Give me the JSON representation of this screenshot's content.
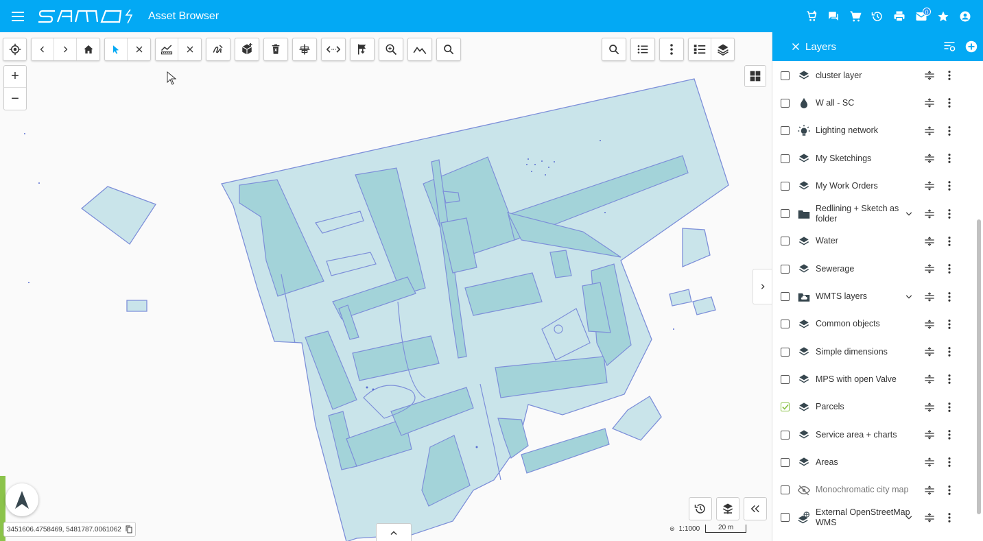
{
  "app": {
    "title": "Asset Browser",
    "logo_text": "samo"
  },
  "header": {
    "actions": [
      {
        "name": "cart-add-icon"
      },
      {
        "name": "chat-icon"
      },
      {
        "name": "cart-icon"
      },
      {
        "name": "history-icon"
      },
      {
        "name": "print-icon"
      },
      {
        "name": "mail-icon",
        "badge": "0"
      },
      {
        "name": "star-icon"
      },
      {
        "name": "account-icon"
      }
    ]
  },
  "colors": {
    "primary": "#03a9f4",
    "map_fill": "#c9e4ea",
    "map_stroke": "#7d8fd9",
    "accent_green": "#8bc34a"
  },
  "map": {
    "coordinates": "3451606.4758469, 5481787.0061062",
    "scale_ratio": "1:1000",
    "scale_bar": "20 m",
    "zoom_in": "+",
    "zoom_out": "−"
  },
  "panel": {
    "title": "Layers",
    "layers": [
      {
        "name": "cluster layer",
        "icon": "layers-icon",
        "checked": false
      },
      {
        "name": "W all - SC",
        "icon": "drop-icon",
        "checked": false
      },
      {
        "name": "Lighting network",
        "icon": "lightbulb-icon",
        "checked": false
      },
      {
        "name": "My Sketchings",
        "icon": "layers-icon",
        "checked": false
      },
      {
        "name": "My Work Orders",
        "icon": "layers-icon",
        "checked": false
      },
      {
        "name": "Redlining + Sketch as folder",
        "icon": "folder-icon",
        "checked": false,
        "expandable": true
      },
      {
        "name": "Water",
        "icon": "layers-icon",
        "checked": false
      },
      {
        "name": "Sewerage",
        "icon": "layers-icon",
        "checked": false
      },
      {
        "name": "WMTS layers",
        "icon": "folder-cloud-icon",
        "checked": false,
        "expandable": true
      },
      {
        "name": "Common objects",
        "icon": "layers-icon",
        "checked": false
      },
      {
        "name": "Simple dimensions",
        "icon": "layers-icon",
        "checked": false
      },
      {
        "name": "MPS with open Valve",
        "icon": "layers-icon",
        "checked": false
      },
      {
        "name": "Parcels",
        "icon": "layers-icon",
        "checked": true
      },
      {
        "name": "Service area + charts",
        "icon": "layers-icon",
        "checked": false
      },
      {
        "name": "Areas",
        "icon": "layers-icon",
        "checked": false
      },
      {
        "name": "Monochromatic city map",
        "icon": "eye-off-icon",
        "checked": false,
        "muted": true
      },
      {
        "name": "External OpenStreetMap WMS",
        "icon": "layers-web-icon",
        "checked": false,
        "expandable": true
      }
    ]
  }
}
